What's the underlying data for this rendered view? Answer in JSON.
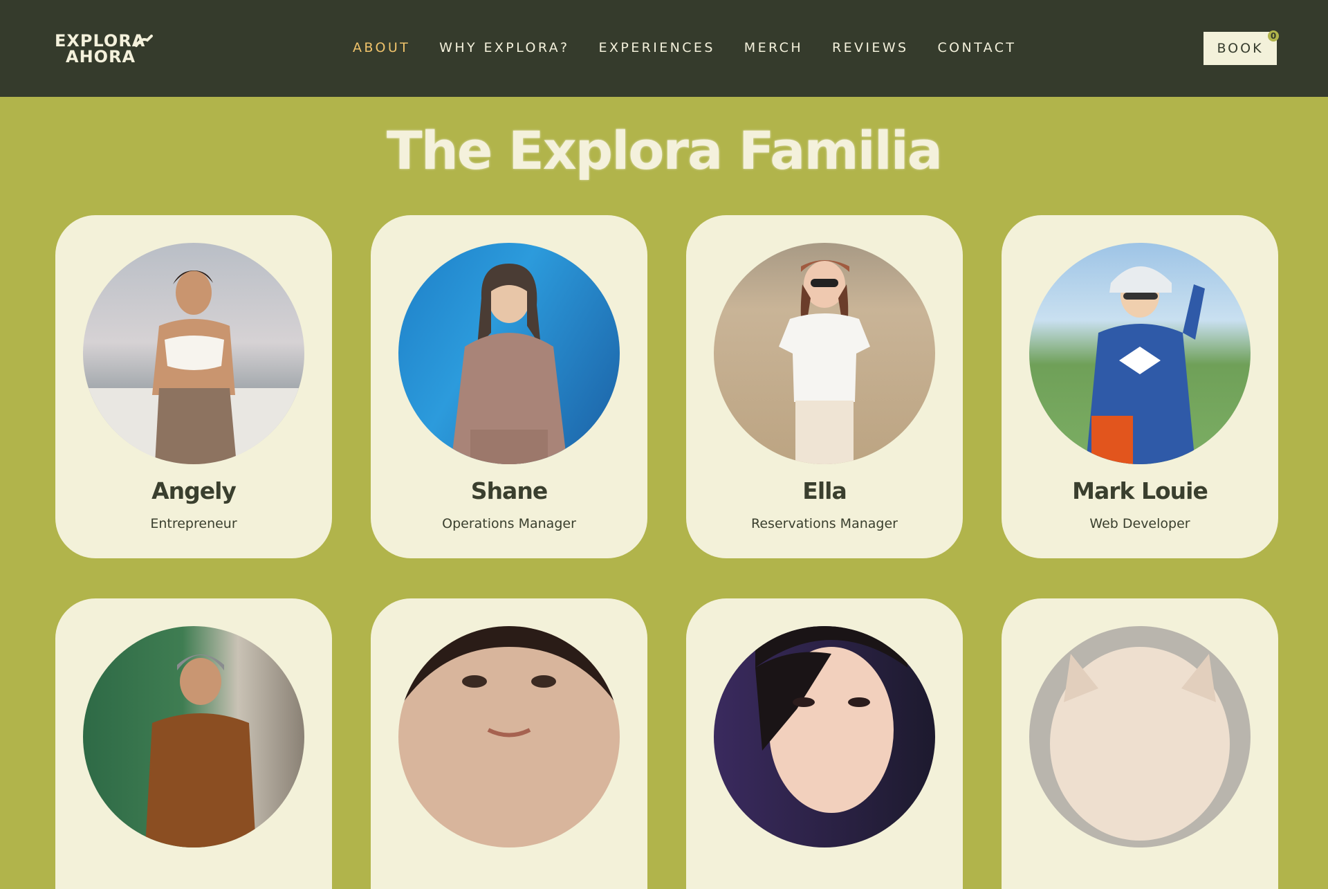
{
  "brand": {
    "logo_line1": "EXPLORA",
    "logo_line2": "AHORA",
    "colors": {
      "header_bg": "#353b2c",
      "page_bg": "#b1b44b",
      "card_bg": "#f3f1d9",
      "accent": "#f0c36b",
      "text_light": "#f4f1dc",
      "text_dark": "#3a3f2e"
    }
  },
  "nav": {
    "items": [
      {
        "label": "ABOUT",
        "active": true
      },
      {
        "label": "WHY EXPLORA?",
        "active": false
      },
      {
        "label": "EXPERIENCES",
        "active": false
      },
      {
        "label": "MERCH",
        "active": false
      },
      {
        "label": "REVIEWS",
        "active": false
      },
      {
        "label": "CONTACT",
        "active": false
      }
    ],
    "book_label": "BOOK",
    "cart_count": "0"
  },
  "main": {
    "title": "The Explora Familia",
    "team": [
      {
        "name": "Angely",
        "role": "Entrepreneur",
        "photo": "photo-angely"
      },
      {
        "name": "Shane",
        "role": "Operations Manager",
        "photo": "photo-shane"
      },
      {
        "name": "Ella",
        "role": "Reservations Manager",
        "photo": "photo-ella"
      },
      {
        "name": "Mark Louie",
        "role": "Web Developer",
        "photo": "photo-mark-louie"
      },
      {
        "name": "",
        "role": "",
        "photo": "photo-team-member-5"
      },
      {
        "name": "",
        "role": "",
        "photo": "photo-team-member-6"
      },
      {
        "name": "",
        "role": "",
        "photo": "photo-team-member-7"
      },
      {
        "name": "",
        "role": "",
        "photo": "photo-team-member-8"
      }
    ]
  }
}
